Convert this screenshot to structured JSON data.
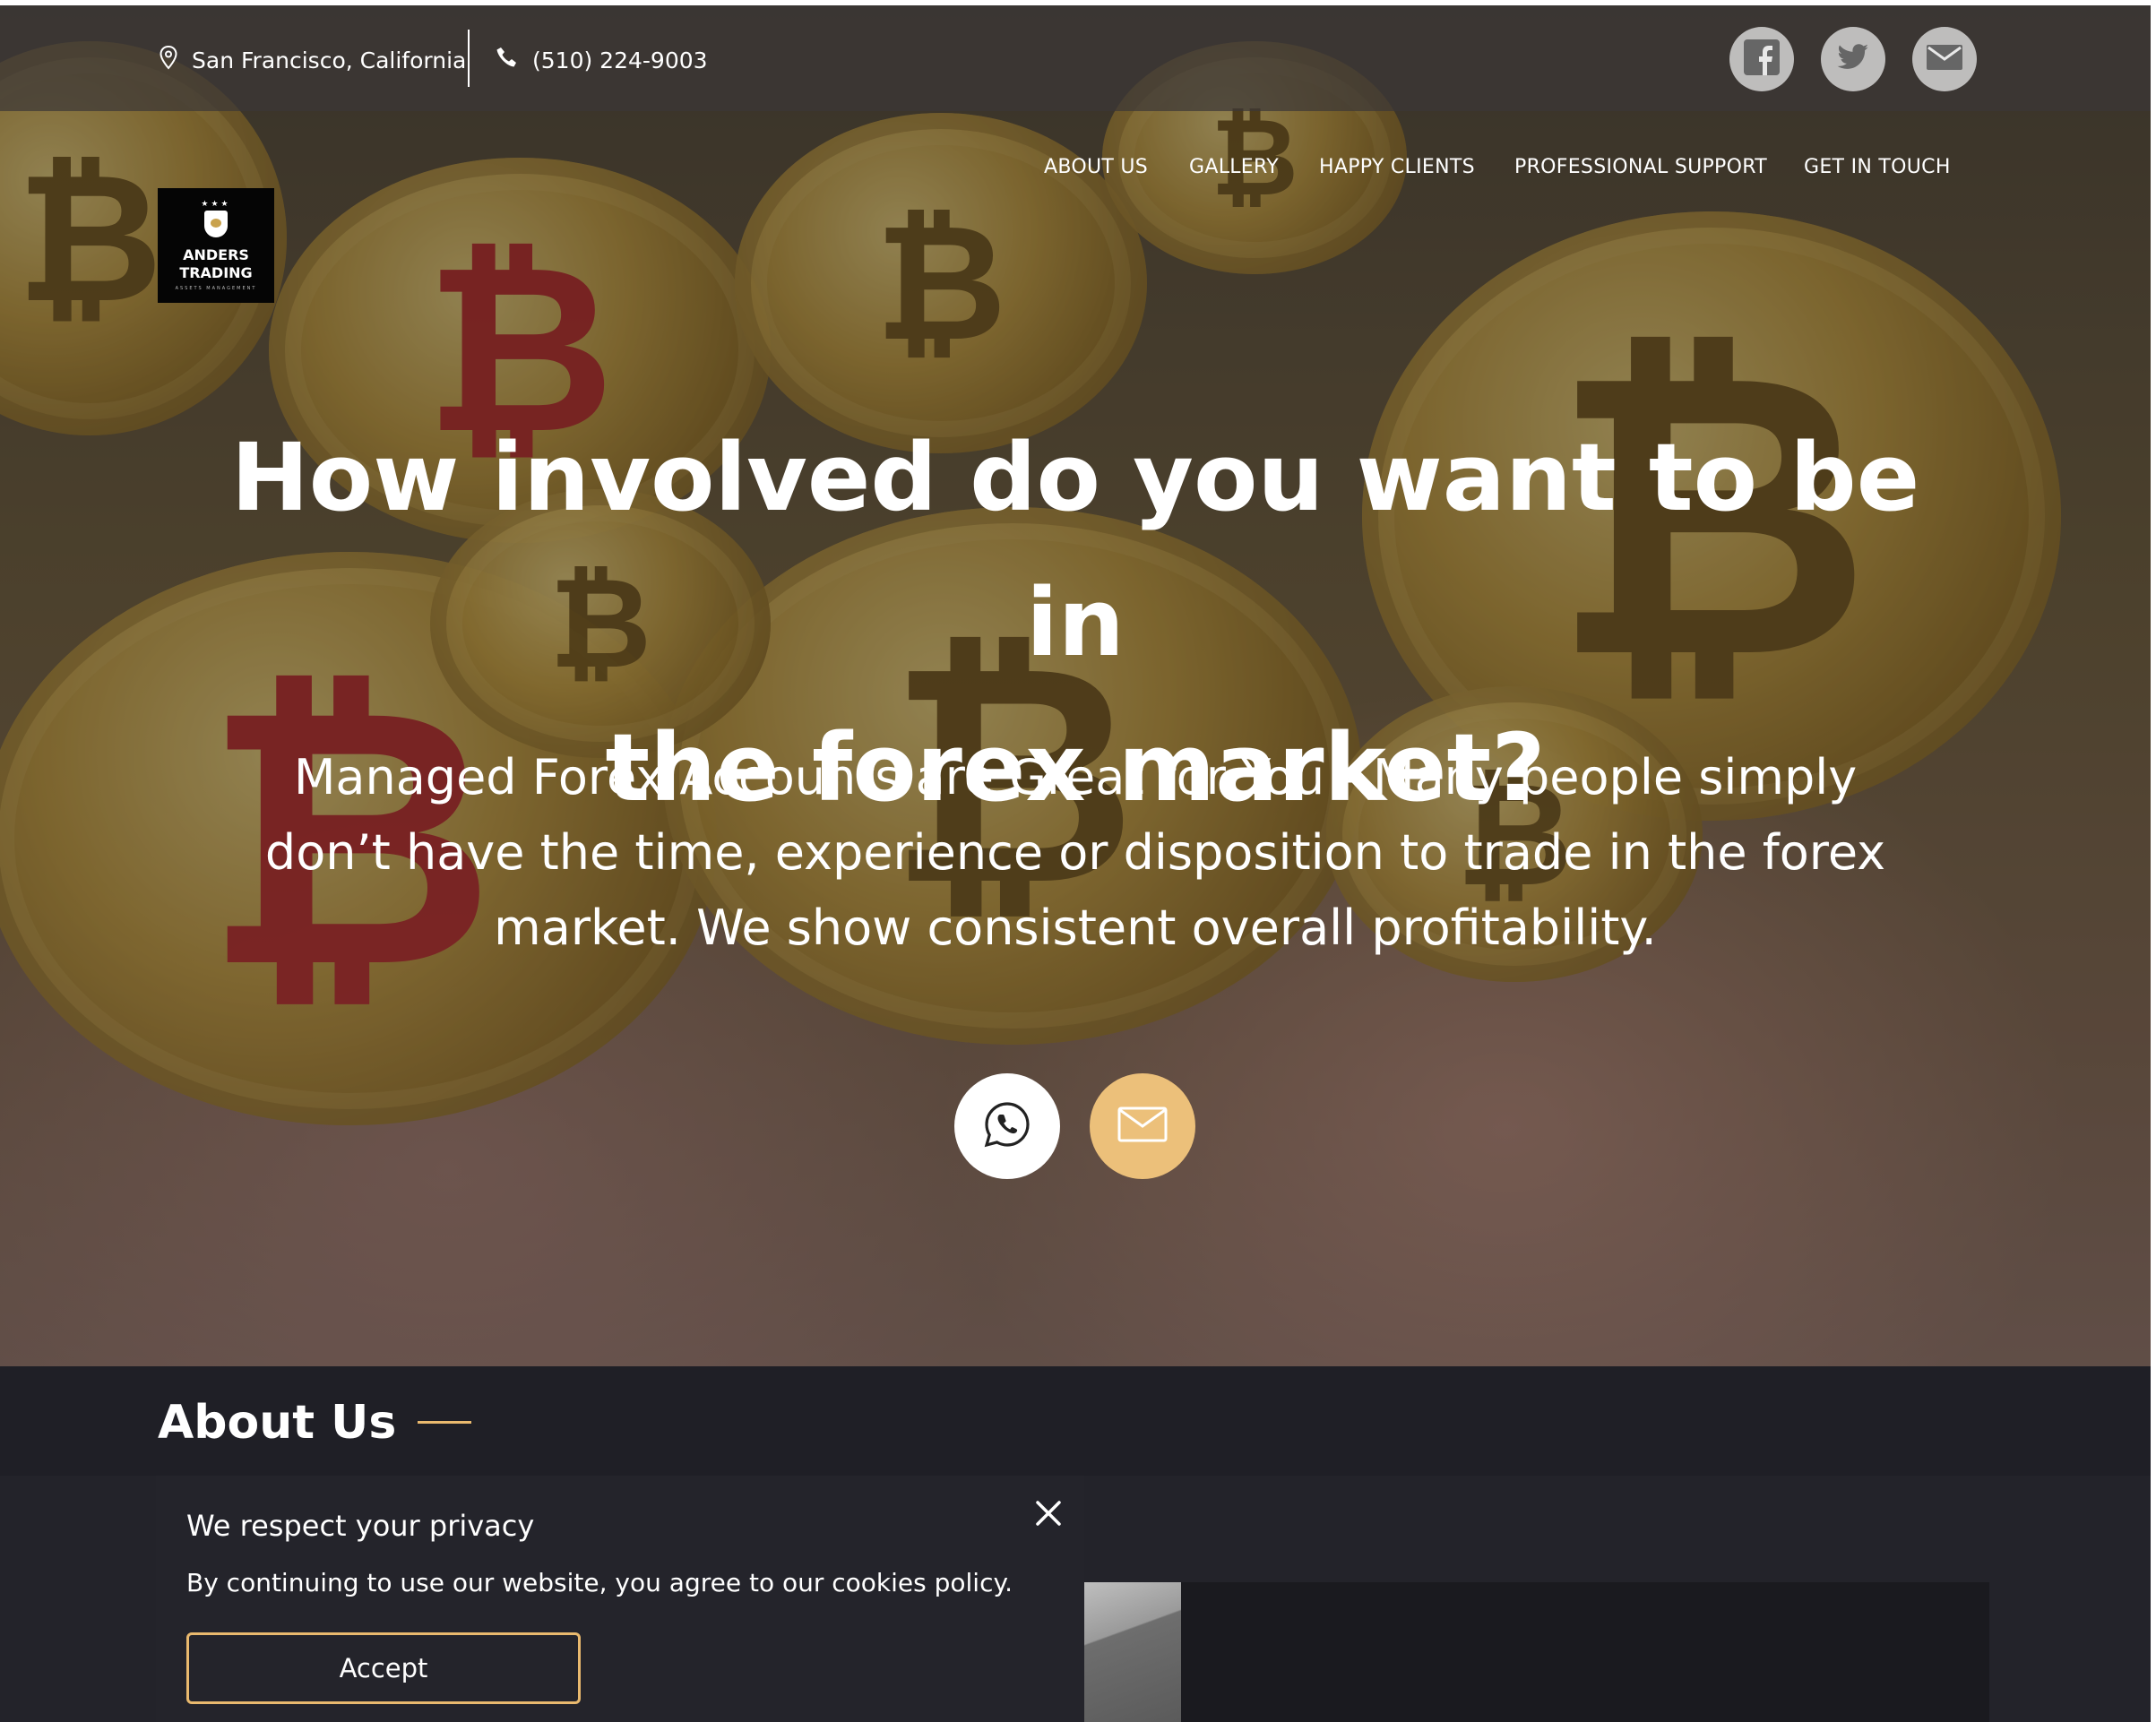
{
  "topbar": {
    "location": "San Francisco, California",
    "phone": "(510) 224-9003",
    "social": [
      {
        "icon": "facebook-icon"
      },
      {
        "icon": "twitter-icon"
      },
      {
        "icon": "mail-icon"
      }
    ]
  },
  "nav": {
    "items": [
      {
        "label": "ABOUT US"
      },
      {
        "label": "GALLERY"
      },
      {
        "label": "HAPPY CLIENTS"
      },
      {
        "label": "PROFESSIONAL SUPPORT"
      },
      {
        "label": "GET IN TOUCH"
      }
    ]
  },
  "logo": {
    "line1": "ANDERS",
    "line2": "TRADING",
    "tagline": "ASSETS MANAGEMENT"
  },
  "hero": {
    "headline_line1": "How involved do you want to be in",
    "headline_line2": "the forex market?",
    "subtitle_line1": "Managed Forex Accounts are Great for You - Many people simply",
    "subtitle_line2": "don’t have the time, experience or disposition to trade in the forex",
    "subtitle_line3": "market. We show consistent overall profitability.",
    "cta_whatsapp_icon": "whatsapp-icon",
    "cta_mail_icon": "mail-icon"
  },
  "about": {
    "title": "About Us"
  },
  "cookie": {
    "title": "We respect your privacy",
    "text": "By continuing to use our website, you agree to our cookies policy.",
    "accept_label": "Accept",
    "close_icon": "close-icon"
  },
  "colors": {
    "accent": "#e9b96e",
    "mail_button": "#ecc07a",
    "dark_bg": "#1f1f26"
  }
}
